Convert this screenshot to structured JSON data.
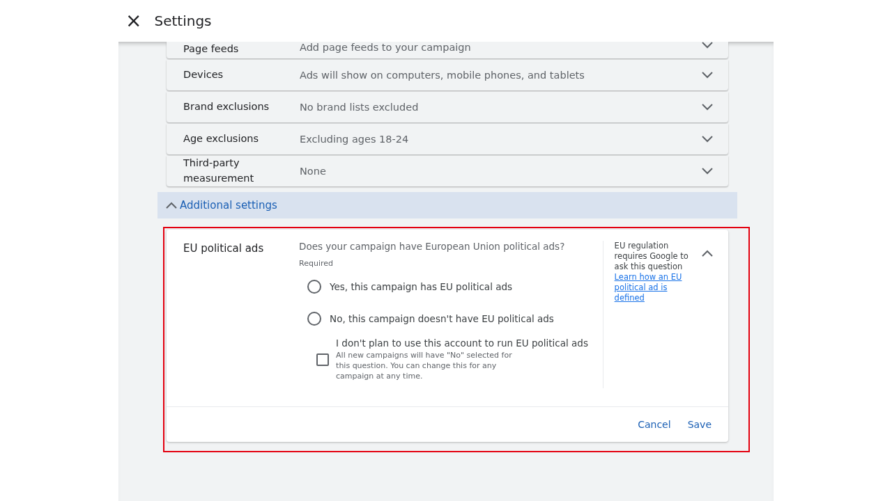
{
  "header": {
    "close_icon": "×",
    "title": "Settings"
  },
  "settings_rows": [
    {
      "label": "Page feeds",
      "value": "Add page feeds to your campaign",
      "expanded": false
    },
    {
      "label": "Devices",
      "value": "Ads will show on computers, mobile phones, and tablets",
      "expanded": false
    },
    {
      "label": "Brand exclusions",
      "value": "No brand lists excluded",
      "expanded": false
    },
    {
      "label": "Age exclusions",
      "value": "Excluding ages 18-24",
      "expanded": false
    },
    {
      "label": "Third-party measurement",
      "value": "None",
      "expanded": false
    }
  ],
  "additional_settings": {
    "label": "Additional settings",
    "expanded": true
  },
  "eu_card": {
    "label": "EU political ads",
    "expanded": true,
    "question": "Does your campaign have European Union political ads?",
    "required": "Required",
    "options": [
      {
        "label": "Yes, this campaign has EU political ads",
        "selected": false
      },
      {
        "label": "No, this campaign doesn't have EU political ads",
        "selected": false
      }
    ],
    "checkbox": {
      "label": "I don't plan to use this account to run EU political ads",
      "hint": "All new campaigns will have \"No\" selected for this question. You can change this for any campaign at any time.",
      "checked": false
    },
    "help_text": "EU regulation requires Google to ask this question",
    "help_link": "Learn how an EU political ad is defined",
    "buttons": [
      "Cancel",
      "Save"
    ]
  }
}
